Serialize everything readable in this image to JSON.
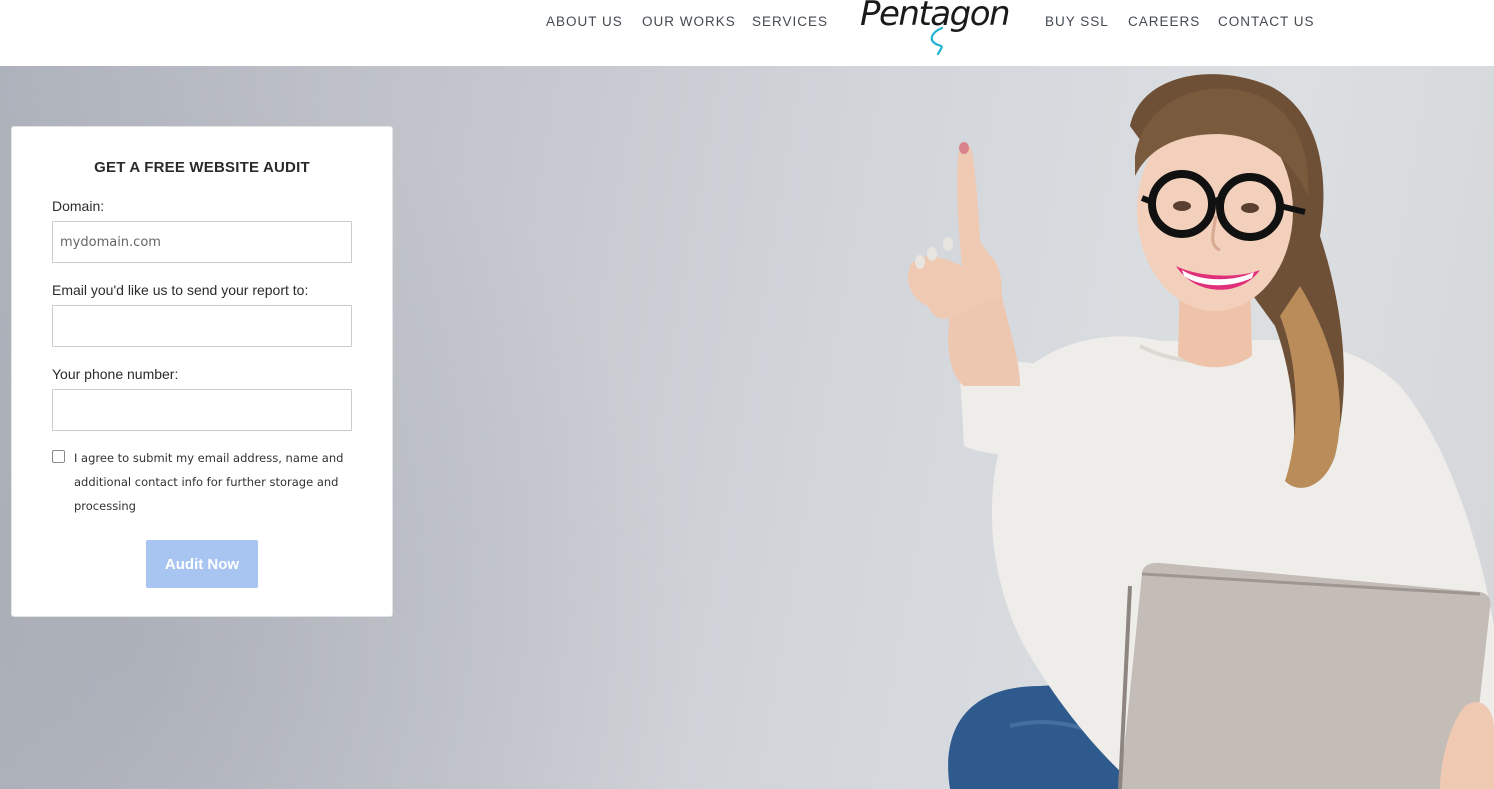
{
  "header": {
    "nav_left": [
      {
        "label": "ABOUT US"
      },
      {
        "label": "OUR WORKS"
      },
      {
        "label": "SERVICES"
      }
    ],
    "logo_text": "Pentagon",
    "nav_right": [
      {
        "label": "BUY SSL"
      },
      {
        "label": "CAREERS"
      },
      {
        "label": "CONTACT US"
      }
    ]
  },
  "audit_form": {
    "title": "GET A FREE WEBSITE AUDIT",
    "domain_label": "Domain:",
    "domain_placeholder": "mydomain.com",
    "domain_value": "",
    "email_label": "Email you'd like us to send your report to:",
    "email_value": "",
    "phone_label": "Your phone number:",
    "phone_value": "",
    "agree_text": "I agree to submit my email address, name and additional contact info for further storage and processing",
    "agree_checked": false,
    "submit_label": "Audit Now"
  },
  "colors": {
    "accent_button": "#a8c4f0",
    "logo_accent": "#1fb3d1",
    "nav_text": "#444a50"
  },
  "images": {
    "hero": "woman-with-glasses-and-laptop-pointing-up"
  }
}
